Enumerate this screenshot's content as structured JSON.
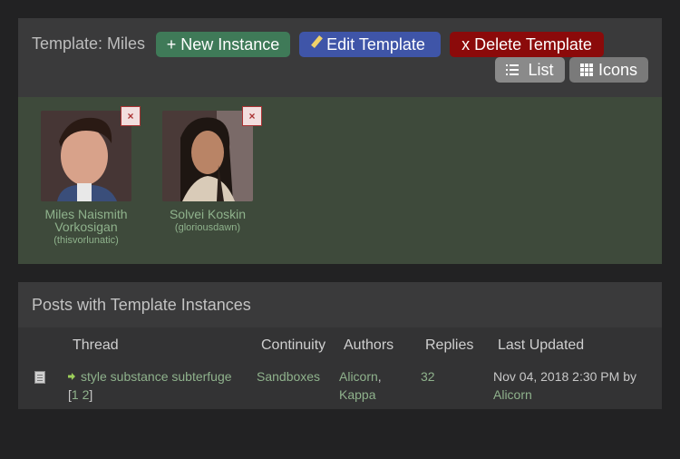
{
  "template": {
    "title": "Template: Miles",
    "new_instance_label": "+ New Instance",
    "edit_label": "Edit Template",
    "delete_label": "x Delete Template",
    "list_label": "List",
    "icons_label": "Icons"
  },
  "characters": [
    {
      "name": "Miles Naismith Vorkosigan",
      "username": "(thisvorlunatic)",
      "remove": "×"
    },
    {
      "name": "Solvei Koskin",
      "username": "(gloriousdawn)",
      "remove": "×"
    }
  ],
  "posts": {
    "title": "Posts with Template Instances",
    "columns": [
      "Thread",
      "Continuity",
      "Authors",
      "Replies",
      "Last Updated"
    ],
    "rows": [
      {
        "thread": "style substance subterfuge",
        "page_open": "[",
        "page1": "1",
        "page2": "2",
        "page_close": "]",
        "continuity": "Sandboxes",
        "author1": "Alicorn",
        "author_sep": ",",
        "author2": "Kappa",
        "replies": "32",
        "updated": "Nov 04, 2018 2:30 PM",
        "by": "by",
        "updated_by": "Alicorn"
      }
    ]
  },
  "colors": {
    "new_button": "#3f7a58",
    "edit_button": "#3f55a8",
    "delete_button": "#8b0a0a",
    "link": "#8fb28c"
  },
  "icons": [
    "pencil-icon",
    "list-icon",
    "grid-icon",
    "close-icon",
    "document-icon",
    "arrow-right-icon"
  ]
}
